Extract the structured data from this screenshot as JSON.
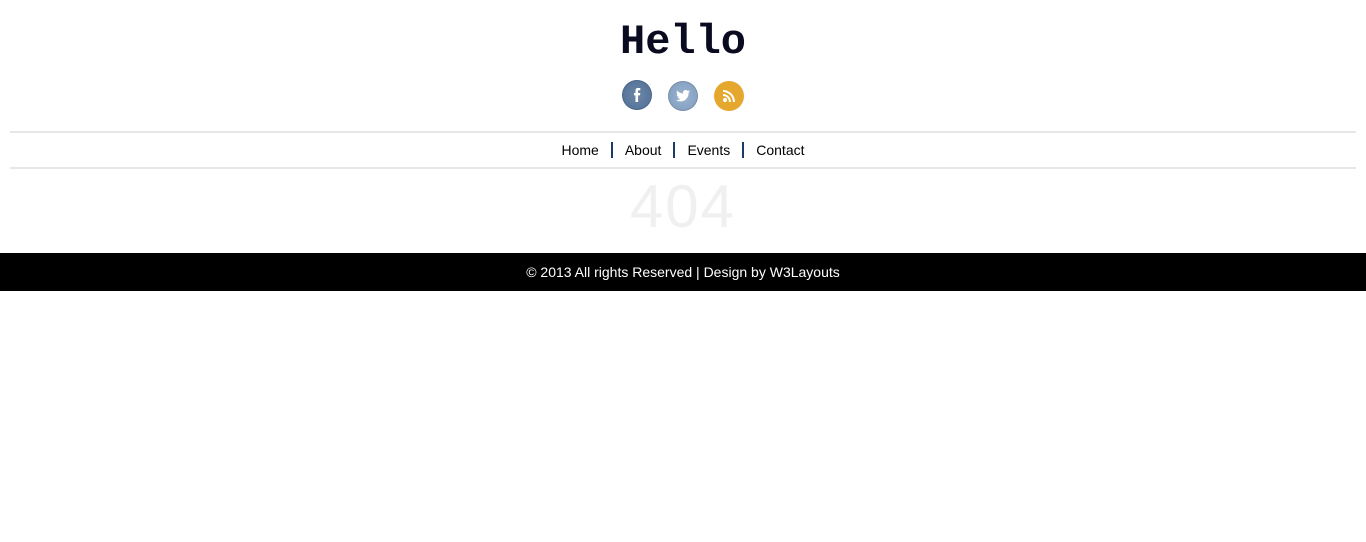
{
  "header": {
    "logo_text": "Hello"
  },
  "social": {
    "facebook": "facebook",
    "twitter": "twitter",
    "rss": "rss"
  },
  "nav": {
    "items": [
      {
        "label": "Home"
      },
      {
        "label": "About"
      },
      {
        "label": "Events"
      },
      {
        "label": "Contact"
      }
    ]
  },
  "content": {
    "error_code": "404"
  },
  "footer": {
    "text_prefix": "© 2013 All rights Reserved | Design by ",
    "link_label": "W3Layouts"
  }
}
